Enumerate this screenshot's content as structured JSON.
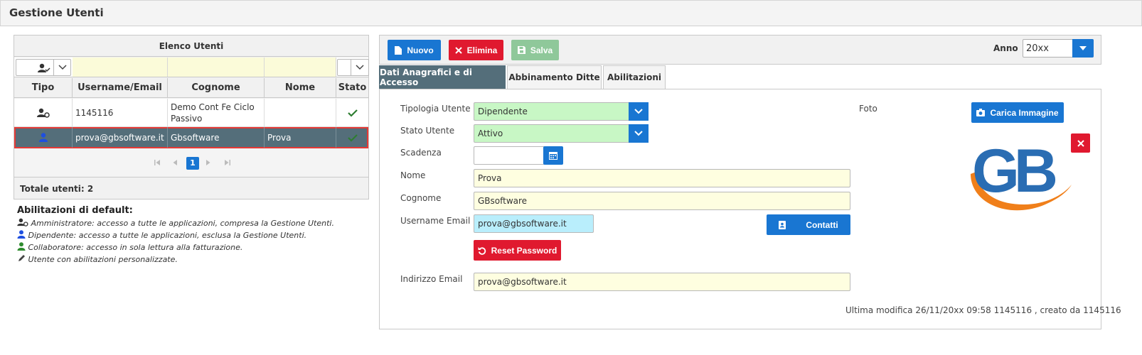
{
  "header": {
    "title": "Gestione Utenti"
  },
  "users_panel": {
    "title": "Elenco Utenti",
    "columns": [
      "Tipo",
      "Username/Email",
      "Cognome",
      "Nome",
      "Stato"
    ],
    "rows": [
      {
        "tipo_icon": "admin-user-icon",
        "username": "1145116",
        "cognome_line1": "Demo Cont Fe Ciclo",
        "cognome_line2": "Passivo",
        "nome": "",
        "stato_icon": "check-icon"
      },
      {
        "tipo_icon": "employee-user-icon",
        "username": "prova@gbsoftware.it",
        "cognome": "Gbsoftware",
        "nome": "Prova",
        "stato_icon": "check-icon",
        "selected": true
      }
    ],
    "pager": {
      "current_page": "1"
    },
    "total": "Totale utenti: 2"
  },
  "defaults": {
    "title": "Abilitazioni di default:",
    "lines": [
      "Amministratore: accesso a tutte le applicazioni, compresa la Gestione Utenti.",
      "Dipendente: accesso a tutte le applicazioni, esclusa la Gestione Utenti.",
      "Collaboratore: accesso in sola lettura alla fatturazione.",
      "Utente con abilitazioni personalizzate."
    ]
  },
  "toolbar": {
    "new_label": "Nuovo",
    "delete_label": "Elimina",
    "save_label": "Salva",
    "year_label": "Anno",
    "year_value": "20xx"
  },
  "tabs": [
    {
      "label": "Dati Anagrafici e di Accesso",
      "active": true
    },
    {
      "label": "Abbinamento Ditte"
    },
    {
      "label": "Abilitazioni"
    }
  ],
  "form": {
    "tipologia_label": "Tipologia Utente",
    "tipologia_value": "Dipendente",
    "stato_label": "Stato Utente",
    "stato_value": "Attivo",
    "scadenza_label": "Scadenza",
    "scadenza_value": "",
    "nome_label": "Nome",
    "nome_value": "Prova",
    "cognome_label": "Cognome",
    "cognome_value": "GBsoftware",
    "username_label": "Username Email",
    "username_value": "prova@gbsoftware.it",
    "contatti_label": "Contatti",
    "reset_label": "Reset Password",
    "email_label": "Indirizzo Email",
    "email_value": "prova@gbsoftware.it",
    "foto_label": "Foto",
    "upload_label": "Carica Immagine",
    "logo_text": "GB",
    "last_modified": "Ultima modifica 26/11/20xx 09:58 1145116 , creato da 1145116"
  },
  "colors": {
    "primary": "#1976d2",
    "danger": "#e0192f",
    "success_disabled": "#8fc89a",
    "header_dark": "#546e7a",
    "logo_blue": "#2a6db3",
    "logo_orange": "#f07f1a"
  }
}
